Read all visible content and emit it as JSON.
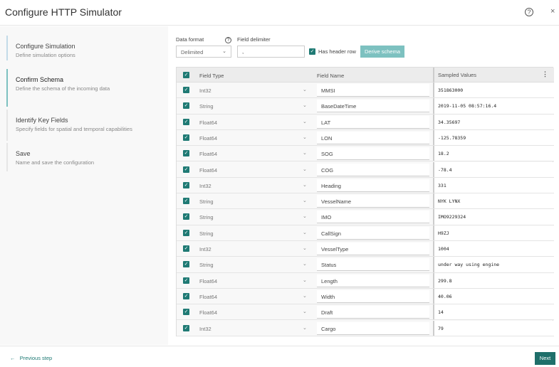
{
  "header": {
    "title": "Configure HTTP Simulator",
    "help_icon": "?",
    "close_icon": "×"
  },
  "steps": [
    {
      "title": "Configure Simulation",
      "desc": "Define simulation options"
    },
    {
      "title": "Confirm Schema",
      "desc": "Define the schema of the incoming data"
    },
    {
      "title": "Identify Key Fields",
      "desc": "Specify fields for spatial and temporal capabilities"
    },
    {
      "title": "Save",
      "desc": "Name and save the configuration"
    }
  ],
  "form": {
    "data_format_label": "Data format",
    "data_format_value": "Delimited",
    "help_icon": "?",
    "delimiter_label": "Field delimiter",
    "delimiter_value": ",",
    "header_row_label": "Has header row",
    "derive_label": "Derive schema"
  },
  "table": {
    "headers": [
      "Field Type",
      "Field Name",
      "Sampled Values"
    ],
    "rows": [
      [
        "Int32",
        "MMSI",
        "351863000"
      ],
      [
        "String",
        "BaseDateTime",
        "2019-11-05 08:57:16.4"
      ],
      [
        "Float64",
        "LAT",
        "34.35697"
      ],
      [
        "Float64",
        "LON",
        "-125.78359"
      ],
      [
        "Float64",
        "SOG",
        "18.2"
      ],
      [
        "Float64",
        "COG",
        "-78.4"
      ],
      [
        "Int32",
        "Heading",
        "331"
      ],
      [
        "String",
        "VesselName",
        "NYK LYNX"
      ],
      [
        "String",
        "IMO",
        "IMO9229324"
      ],
      [
        "String",
        "CallSign",
        "H9ZJ"
      ],
      [
        "Int32",
        "VesselType",
        "1004"
      ],
      [
        "String",
        "Status",
        "under way using engine"
      ],
      [
        "Float64",
        "Length",
        "299.8"
      ],
      [
        "Float64",
        "Width",
        "40.06"
      ],
      [
        "Float64",
        "Draft",
        "14"
      ],
      [
        "Int32",
        "Cargo",
        "79"
      ]
    ]
  },
  "footer": {
    "prev_label": "Previous step",
    "next_label": "Next"
  }
}
